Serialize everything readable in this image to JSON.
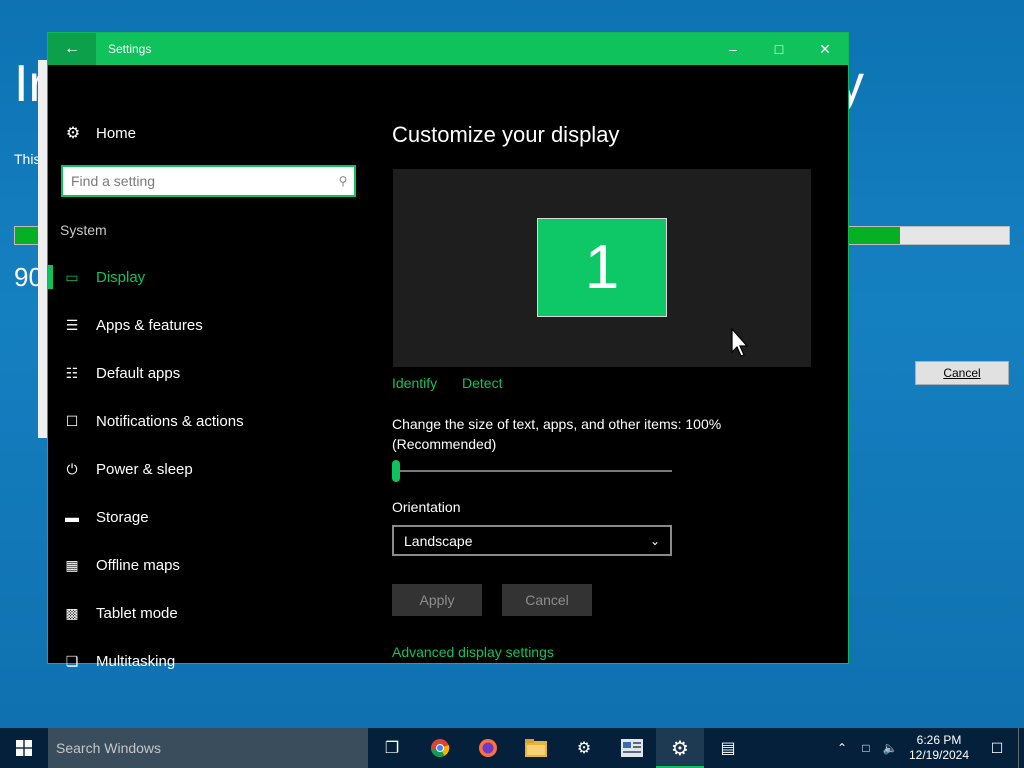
{
  "background_installer": {
    "title_fragment_left": "Ir",
    "title_fragment_right": "y",
    "subtitle_fragment": "This",
    "progress_fraction": 0.89,
    "percent_fragment": "90",
    "cancel_label": "Cancel"
  },
  "window": {
    "title": "Settings",
    "back_icon": "arrow-left-icon",
    "minimize_icon": "minimize-icon",
    "maximize_icon": "maximize-icon",
    "close_icon": "close-icon"
  },
  "sidebar": {
    "home_label": "Home",
    "search_placeholder": "Find a setting",
    "section_label": "System",
    "items": [
      {
        "label": "Display",
        "icon": "monitor-icon",
        "active": true
      },
      {
        "label": "Apps & features",
        "icon": "list-icon",
        "active": false
      },
      {
        "label": "Default apps",
        "icon": "default-apps-icon",
        "active": false
      },
      {
        "label": "Notifications & actions",
        "icon": "message-icon",
        "active": false
      },
      {
        "label": "Power & sleep",
        "icon": "power-icon",
        "active": false
      },
      {
        "label": "Storage",
        "icon": "storage-icon",
        "active": false
      },
      {
        "label": "Offline maps",
        "icon": "map-icon",
        "active": false
      },
      {
        "label": "Tablet mode",
        "icon": "tablet-icon",
        "active": false
      },
      {
        "label": "Multitasking",
        "icon": "multitasking-icon",
        "active": false
      }
    ]
  },
  "content": {
    "title": "Customize your display",
    "monitor_number": "1",
    "identify_label": "Identify",
    "detect_label": "Detect",
    "scale_label": "Change the size of text, apps, and other items: 100% (Recommended)",
    "scale_fraction": 0.0,
    "orientation_label": "Orientation",
    "orientation_value": "Landscape",
    "apply_label": "Apply",
    "cancel_label": "Cancel",
    "advanced_label": "Advanced display settings"
  },
  "taskbar": {
    "search_placeholder": "Search Windows",
    "apps": [
      {
        "name": "task-view-icon",
        "active": false
      },
      {
        "name": "chrome-icon",
        "active": false
      },
      {
        "name": "firefox-icon",
        "active": false
      },
      {
        "name": "file-explorer-icon",
        "active": false
      },
      {
        "name": "installer-icon",
        "active": false
      },
      {
        "name": "document-viewer-icon",
        "active": false
      },
      {
        "name": "settings-gear-icon",
        "active": true
      },
      {
        "name": "program-icon",
        "active": false
      }
    ],
    "time": "6:26 PM",
    "date": "12/19/2024"
  },
  "colors": {
    "accent": "#10c25b",
    "titlebar": "#10c25b",
    "taskbar": "#04203a",
    "desktop": "#0d73b3"
  }
}
